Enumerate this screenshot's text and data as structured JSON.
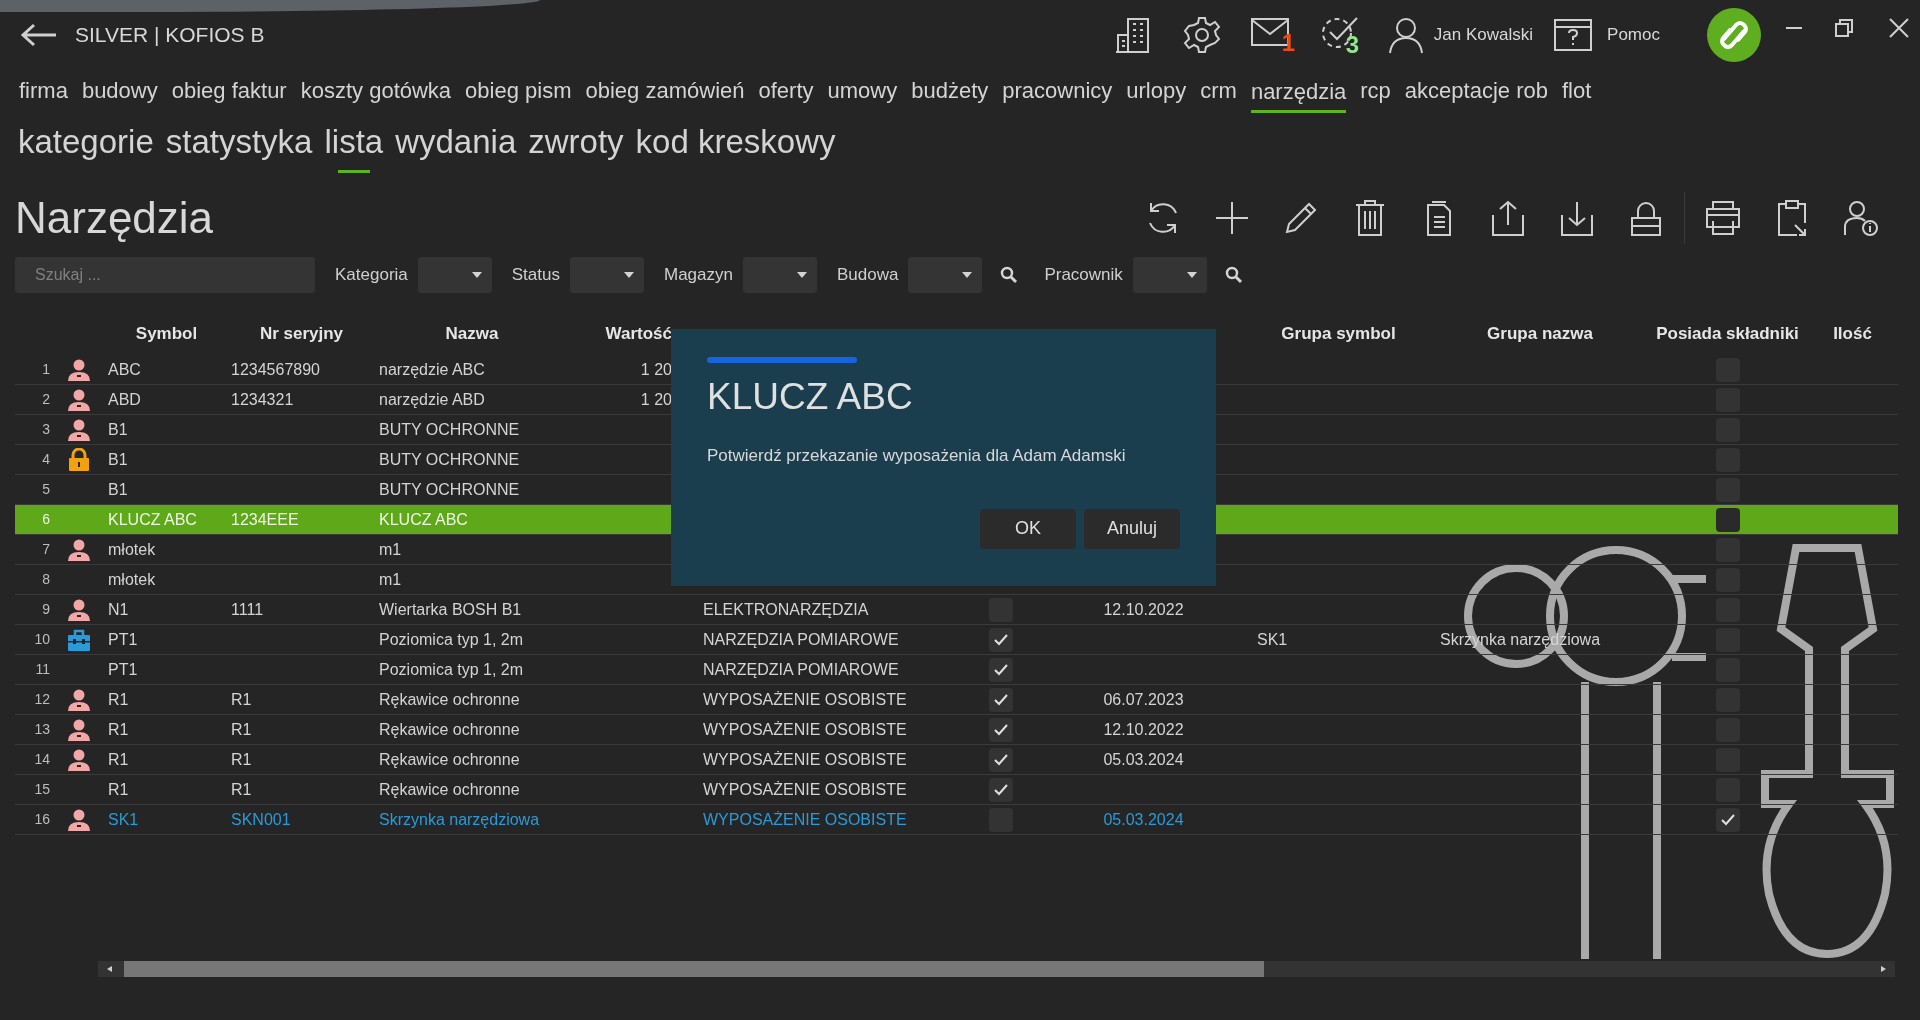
{
  "window": {
    "title": "SILVER | KOFIOS B"
  },
  "header": {
    "mail_count": "1",
    "tasks_count": "3",
    "user": "Jan Kowalski",
    "help": "Pomoc"
  },
  "nav": [
    {
      "label": "firma",
      "selected": false
    },
    {
      "label": "budowy",
      "selected": false
    },
    {
      "label": "obieg faktur",
      "selected": false
    },
    {
      "label": "koszty gotówka",
      "selected": false
    },
    {
      "label": "obieg pism",
      "selected": false
    },
    {
      "label": "obieg zamówień",
      "selected": false
    },
    {
      "label": "oferty",
      "selected": false
    },
    {
      "label": "umowy",
      "selected": false
    },
    {
      "label": "budżety",
      "selected": false
    },
    {
      "label": "pracownicy",
      "selected": false
    },
    {
      "label": "urlopy",
      "selected": false
    },
    {
      "label": "crm",
      "selected": false
    },
    {
      "label": "narzędzia",
      "selected": true
    },
    {
      "label": "rcp",
      "selected": false
    },
    {
      "label": "akceptacje rob",
      "selected": false
    },
    {
      "label": "flot",
      "selected": false
    }
  ],
  "subnav": [
    {
      "label": "kategorie",
      "selected": false
    },
    {
      "label": "statystyka",
      "selected": false
    },
    {
      "label": "lista",
      "selected": true
    },
    {
      "label": "wydania",
      "selected": false
    },
    {
      "label": "zwroty",
      "selected": false
    },
    {
      "label": "kod kreskowy",
      "selected": false
    }
  ],
  "page_title": "Narzędzia",
  "filters": {
    "search_placeholder": "Szukaj ...",
    "items": [
      {
        "kind": "dropdown",
        "label": "Kategoria"
      },
      {
        "kind": "dropdown",
        "label": "Status"
      },
      {
        "kind": "dropdown",
        "label": "Magazyn"
      },
      {
        "kind": "dropdown",
        "label": "Budowa"
      },
      {
        "kind": "search_button"
      },
      {
        "kind": "dropdown",
        "label": "Pracownik"
      },
      {
        "kind": "search_button"
      }
    ]
  },
  "table": {
    "headers": [
      "Symbol",
      "Nr seryjny",
      "Nazwa",
      "Wartość",
      "Grupa symbol",
      "Grupa nazwa",
      "Posiada składniki",
      "Ilość"
    ],
    "rows": [
      {
        "number": "1",
        "kind": "person",
        "symbol": "ABC",
        "serial": "1234567890",
        "name": "narzędzie ABC",
        "value": "1 20",
        "has_components": false,
        "selected": false,
        "highlighted": false
      },
      {
        "number": "2",
        "kind": "person",
        "symbol": "ABD",
        "serial": "1234321",
        "name": "narzędzie ABD",
        "value": "1 20",
        "has_components": false,
        "selected": false,
        "highlighted": false
      },
      {
        "number": "3",
        "kind": "person",
        "symbol": "B1",
        "name": "BUTY OCHRONNE",
        "has_components": false,
        "selected": false,
        "highlighted": false
      },
      {
        "number": "4",
        "kind": "lock",
        "symbol": "B1",
        "name": "BUTY OCHRONNE",
        "has_components": false,
        "selected": false,
        "highlighted": false
      },
      {
        "number": "5",
        "symbol": "B1",
        "name": "BUTY OCHRONNE",
        "has_components": false,
        "selected": false,
        "highlighted": false
      },
      {
        "number": "6",
        "symbol": "KLUCZ ABC",
        "serial": "1234EEE",
        "name": "KLUCZ ABC",
        "has_components": false,
        "selected": true,
        "highlighted": false
      },
      {
        "number": "7",
        "kind": "person",
        "symbol": "młotek",
        "name": "m1",
        "has_components": false,
        "selected": false,
        "highlighted": false
      },
      {
        "number": "8",
        "symbol": "młotek",
        "name": "m1",
        "has_components": false,
        "selected": false,
        "highlighted": false
      },
      {
        "number": "9",
        "kind": "person",
        "symbol": "N1",
        "serial": "1111",
        "name": "Wiertarka BOSH B1",
        "category": "ELEKTRONARZĘDZIA",
        "has_quantity": false,
        "date": "12.10.2022",
        "has_components": false,
        "selected": false,
        "highlighted": false
      },
      {
        "number": "10",
        "kind": "toolbox",
        "symbol": "PT1",
        "name": "Poziomica typ 1, 2m",
        "category": "NARZĘDZIA POMIAROWE",
        "has_quantity": true,
        "group_symbol": "SK1",
        "group_name": "Skrzynka narzędziowa",
        "has_components": false,
        "selected": false,
        "highlighted": false
      },
      {
        "number": "11",
        "symbol": "PT1",
        "name": "Poziomica typ 1, 2m",
        "category": "NARZĘDZIA POMIAROWE",
        "has_quantity": true,
        "has_components": false,
        "selected": false,
        "highlighted": false
      },
      {
        "number": "12",
        "kind": "person",
        "symbol": "R1",
        "serial": "R1",
        "name": "Rękawice ochronne",
        "category": "WYPOSAŻENIE OSOBISTE",
        "has_quantity": true,
        "date": "06.07.2023",
        "has_components": false,
        "selected": false,
        "highlighted": false
      },
      {
        "number": "13",
        "kind": "person",
        "symbol": "R1",
        "serial": "R1",
        "name": "Rękawice ochronne",
        "category": "WYPOSAŻENIE OSOBISTE",
        "has_quantity": true,
        "date": "12.10.2022",
        "has_components": false,
        "selected": false,
        "highlighted": false
      },
      {
        "number": "14",
        "kind": "person",
        "symbol": "R1",
        "serial": "R1",
        "name": "Rękawice ochronne",
        "category": "WYPOSAŻENIE OSOBISTE",
        "has_quantity": true,
        "date": "05.03.2024",
        "has_components": false,
        "selected": false,
        "highlighted": false
      },
      {
        "number": "15",
        "symbol": "R1",
        "serial": "R1",
        "name": "Rękawice ochronne",
        "category": "WYPOSAŻENIE OSOBISTE",
        "has_quantity": true,
        "has_components": false,
        "selected": false,
        "highlighted": false
      },
      {
        "number": "16",
        "kind": "person",
        "symbol": "SK1",
        "serial": "SKN001",
        "name": "Skrzynka narzędziowa",
        "category": "WYPOSAŻENIE OSOBISTE",
        "has_quantity": false,
        "date": "05.03.2024",
        "has_components": true,
        "selected": false,
        "highlighted": true
      }
    ]
  },
  "dialog": {
    "title": "KLUCZ ABC",
    "message": "Potwierdź przekazanie wyposażenia dla Adam Adamski",
    "buttons": [
      "OK",
      "Anuluj"
    ]
  }
}
